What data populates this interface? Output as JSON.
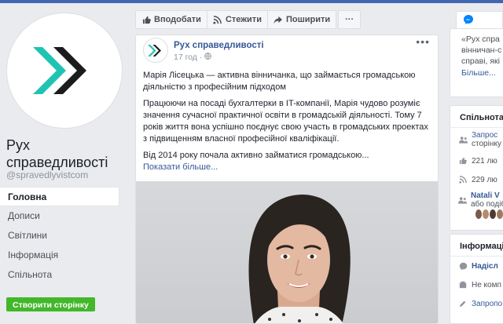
{
  "page": {
    "name": "Рух справедливості",
    "handle": "@spravedlyvistcom"
  },
  "nav": {
    "items": [
      {
        "label": "Головна",
        "active": true
      },
      {
        "label": "Дописи"
      },
      {
        "label": "Світлини"
      },
      {
        "label": "Інформація"
      },
      {
        "label": "Спільнота"
      }
    ],
    "create_page": "Створити сторінку"
  },
  "actions": {
    "like": "Вподобати",
    "follow": "Стежити",
    "share": "Поширити",
    "more": "···"
  },
  "post": {
    "author": "Рух справедливості",
    "time": "17 год ·",
    "dots": "•••",
    "p1": "Марія Лісецька — активна вінничанка, що займається громадською діяльністю з професійним підходом",
    "p2": "Працюючи на посаді бухгалтерки в IT-компанії, Марія чудово розуміє значення сучасної практичної освіти в громадській діяльності. Тому 7 років життя вона успішно поєднує свою участь в громадських проектах з підвищенням власної професійної кваліфікації.",
    "p3": "Від 2014 року почала активно займатися громадською...",
    "see_more": "Показати більше..."
  },
  "right": {
    "quote_lines": [
      "«Рух спра",
      "вінничан-с",
      "справі, які"
    ],
    "more": "Більше...",
    "community_title": "Спільнота",
    "community_rows": [
      {
        "line1": "Запрос",
        "line2": "сторінку"
      },
      {
        "text": "221 лю"
      },
      {
        "text": "229 лю"
      },
      {
        "name": "Natali V",
        "line2": "або подіб"
      }
    ],
    "info_title": "Інформаці",
    "info_rows": [
      {
        "text": "Надісл"
      },
      {
        "text": "Не комп"
      },
      {
        "text": "Запропо"
      }
    ]
  },
  "colors": {
    "logo_teal": "#1ec3b3",
    "logo_dark": "#1c1c1c",
    "create_button": "#42b72a",
    "link": "#365899"
  }
}
